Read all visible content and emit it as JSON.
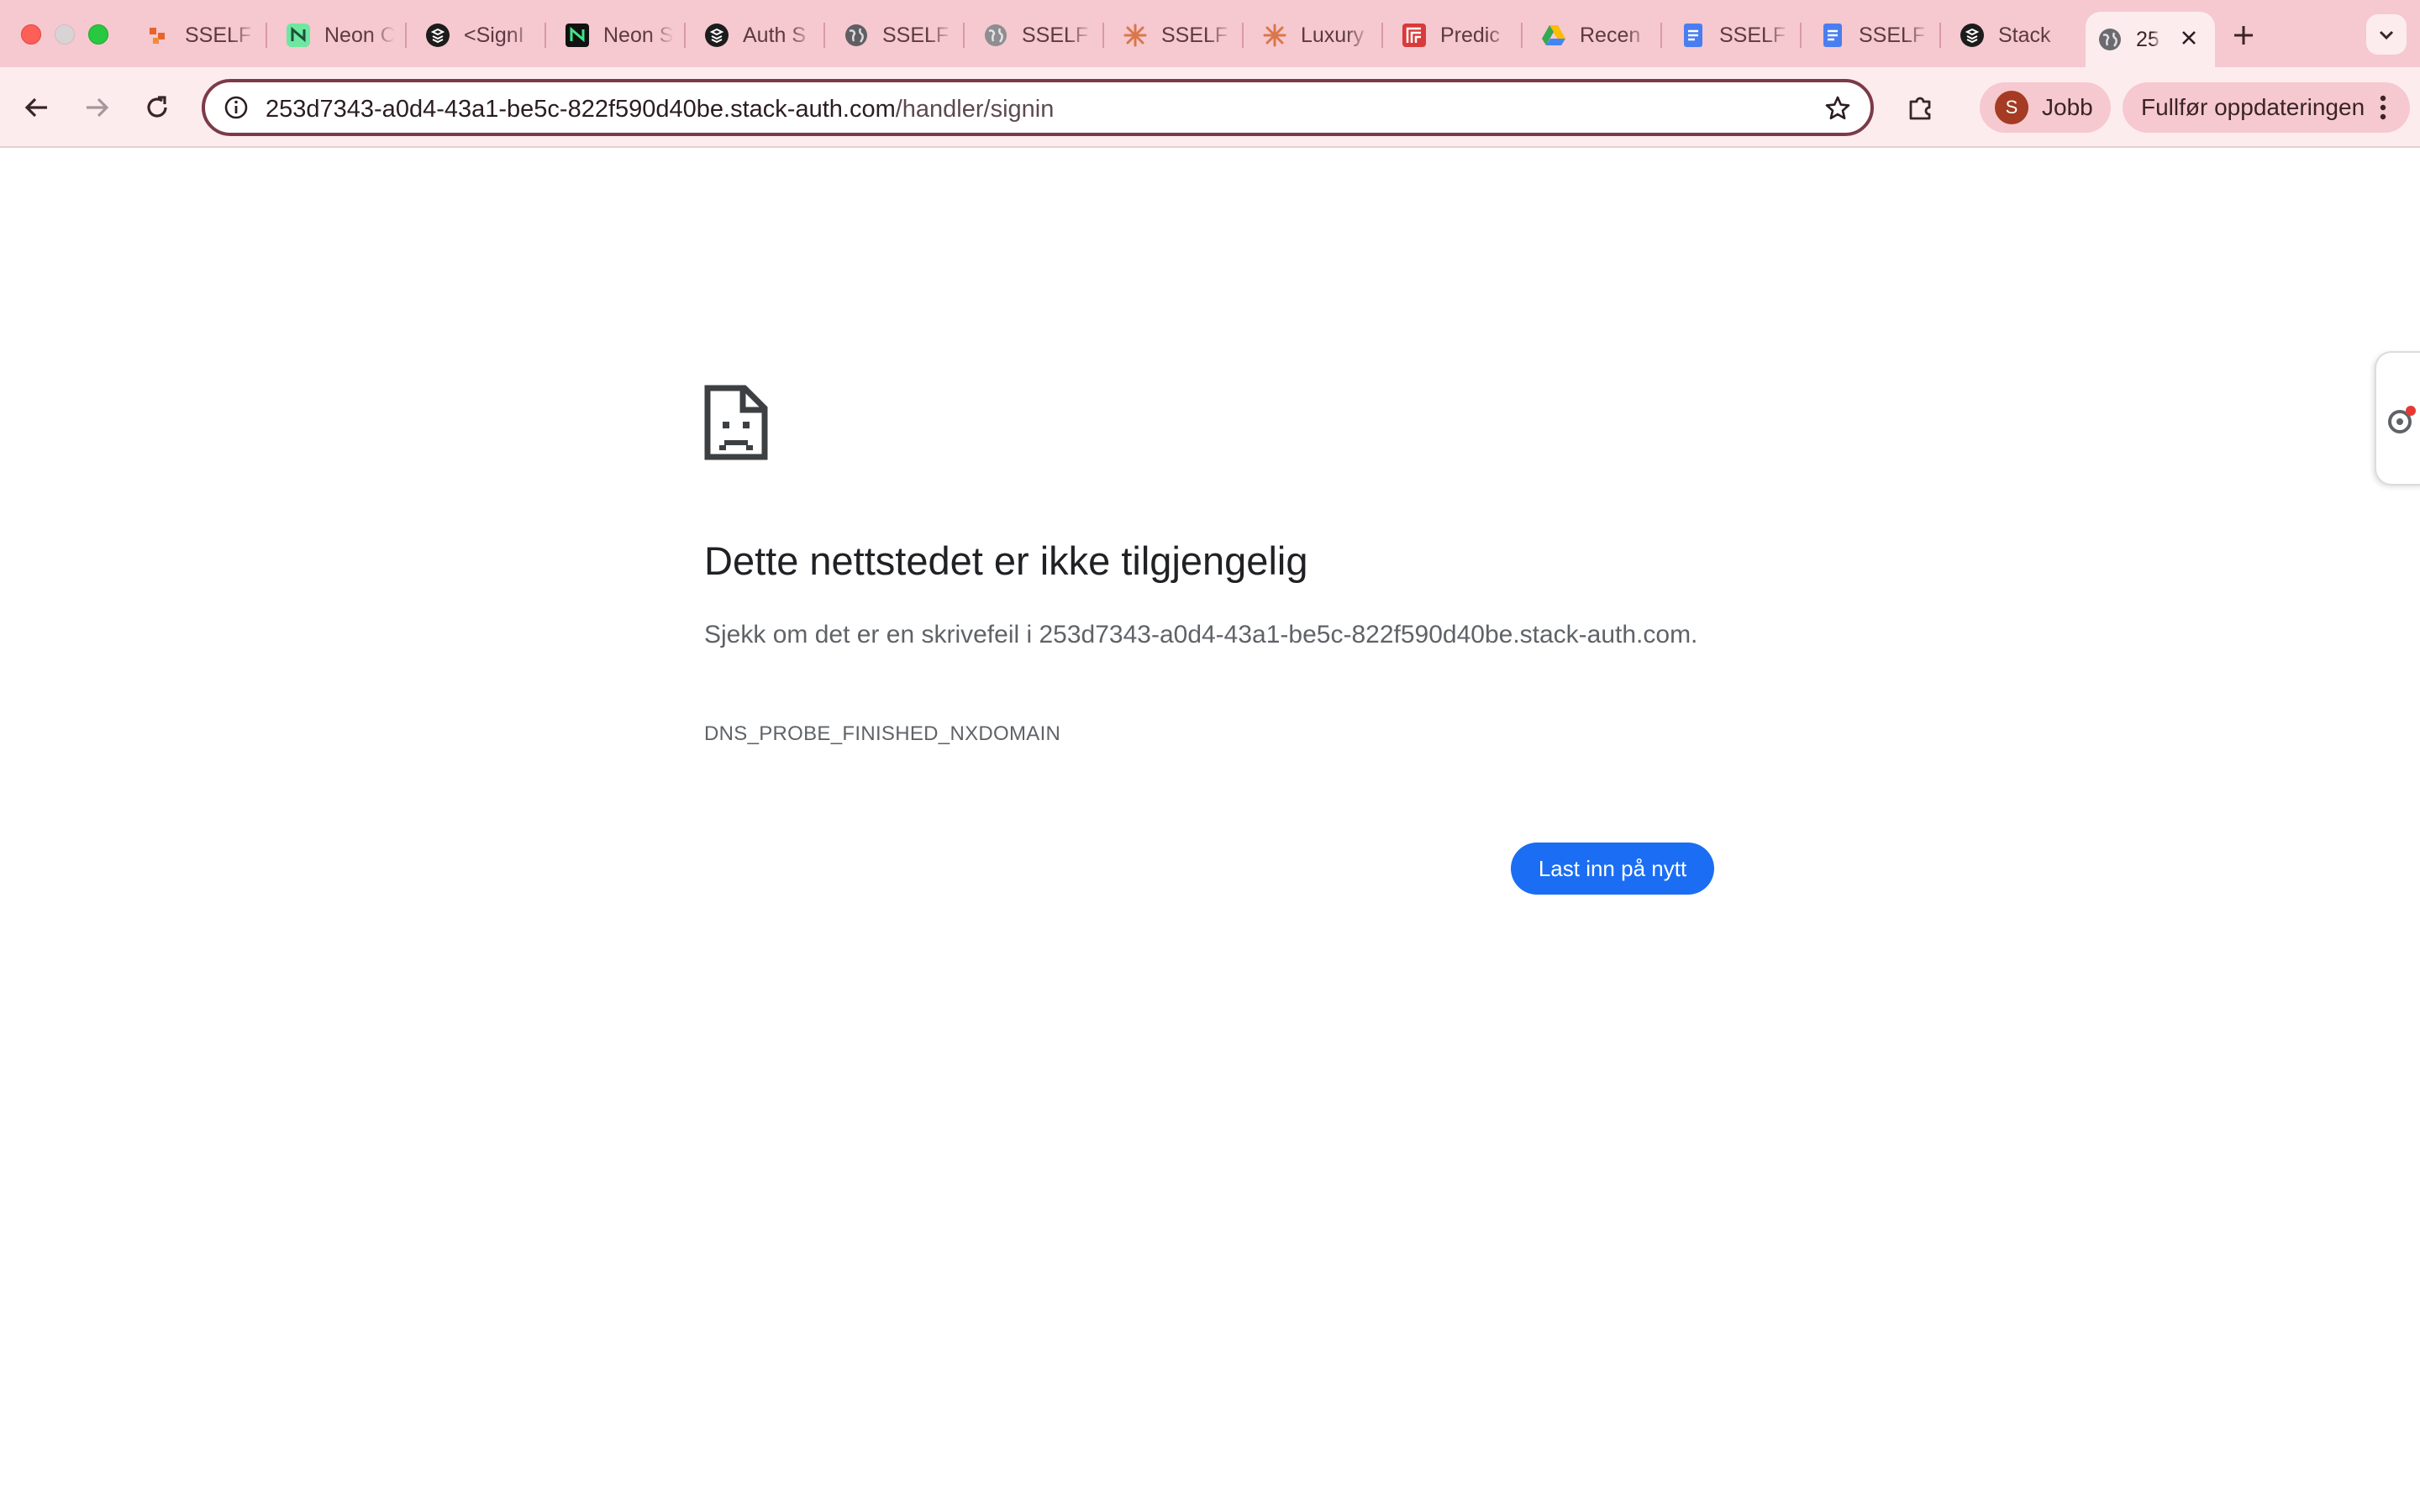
{
  "tabs": [
    {
      "title": "SSELF",
      "icon": "orange-squares-icon"
    },
    {
      "title": "Neon C",
      "icon": "neon-logo-icon"
    },
    {
      "title": "<SignI",
      "icon": "stack-auth-icon"
    },
    {
      "title": "Neon S",
      "icon": "neon-dark-logo-icon"
    },
    {
      "title": "Auth S",
      "icon": "stack-auth-icon"
    },
    {
      "title": "SSELF",
      "icon": "globe-icon"
    },
    {
      "title": "SSELF",
      "icon": "globe-icon"
    },
    {
      "title": "SSELF",
      "icon": "claude-icon"
    },
    {
      "title": "Luxury",
      "icon": "claude-icon"
    },
    {
      "title": "Predic",
      "icon": "red-logo-icon"
    },
    {
      "title": "Recen",
      "icon": "google-drive-icon"
    },
    {
      "title": "SSELF",
      "icon": "google-docs-icon"
    },
    {
      "title": "SSELF",
      "icon": "google-docs-icon"
    },
    {
      "title": "Stack",
      "icon": "stack-auth-icon"
    }
  ],
  "active_tab": {
    "title": "25",
    "icon": "globe-icon"
  },
  "toolbar": {
    "url_host": "253d7343-a0d4-43a1-be5c-822f590d40be.stack-auth.com",
    "url_path": "/handler/signin",
    "profile_initial": "S",
    "profile_name": "Jobb",
    "update_label": "Fullfør oppdateringen"
  },
  "error_page": {
    "title": "Dette nettstedet er ikke tilgjengelig",
    "description": "Sjekk om det er en skrivefeil i 253d7343-a0d4-43a1-be5c-822f590d40be.stack-auth.com.",
    "code": "DNS_PROBE_FINISHED_NXDOMAIN",
    "reload_label": "Last inn på nytt"
  },
  "colors": {
    "tabstrip": "#f6c8cf",
    "toolbar": "#fdecee",
    "omnibox_border": "#7c3a48",
    "button_blue": "#1b6ef3",
    "avatar": "#a43b22"
  }
}
